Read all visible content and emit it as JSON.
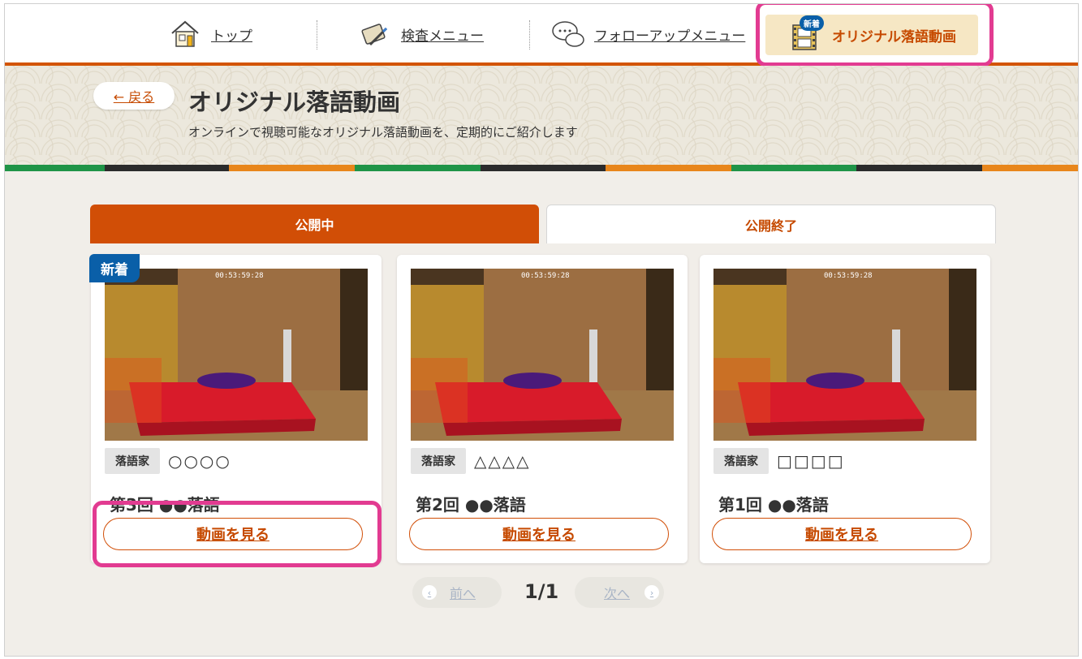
{
  "nav": {
    "items": [
      {
        "label": "トップ",
        "icon": "house-icon"
      },
      {
        "label": "検査メニュー",
        "icon": "notebook-pen-icon"
      },
      {
        "label": "フォローアップメニュー",
        "icon": "speech-bubbles-icon"
      }
    ],
    "active": {
      "label": "オリジナル落語動画",
      "badge": "新着",
      "icon": "film-icon"
    }
  },
  "hero": {
    "back_label": "← 戻る",
    "title": "オリジナル落語動画",
    "subtitle": "オンラインで視聴可能なオリジナル落語動画を、定期的にご紹介します"
  },
  "tabs": [
    {
      "label": "公開中",
      "active": true
    },
    {
      "label": "公開終了",
      "active": false
    }
  ],
  "cards": [
    {
      "badge": "新着",
      "timestamp": "00:53:59:28",
      "tag": "落語家",
      "performer": "○○○○",
      "title": "第3回 ●●落語",
      "button": "動画を見る"
    },
    {
      "badge": "",
      "timestamp": "00:53:59:28",
      "tag": "落語家",
      "performer": "△△△△",
      "title": "第2回 ●●落語",
      "button": "動画を見る"
    },
    {
      "badge": "",
      "timestamp": "00:53:59:28",
      "tag": "落語家",
      "performer": "□□□□",
      "title": "第1回 ●●落語",
      "button": "動画を見る"
    }
  ],
  "pager": {
    "prev": "前へ",
    "next": "次へ",
    "count": "1/1"
  },
  "colors": {
    "accent": "#d14e06",
    "badge_blue": "#0a5fa8",
    "highlight": "#e23b91",
    "active_nav_bg": "#f6e7c4"
  }
}
